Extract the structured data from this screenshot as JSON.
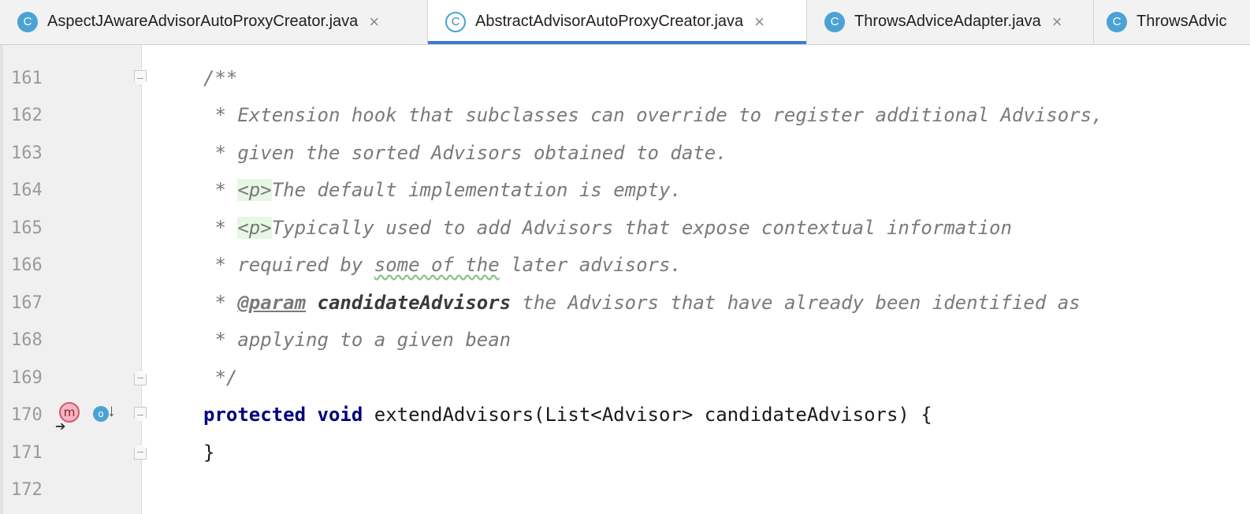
{
  "tabs": [
    {
      "label": "AspectJAwareAdvisorAutoProxyCreator.java",
      "icon": "class-icon",
      "icon_glyph": "C",
      "active": false
    },
    {
      "label": "AbstractAdvisorAutoProxyCreator.java",
      "icon": "class-icon",
      "icon_glyph": "C",
      "active": true
    },
    {
      "label": "ThrowsAdviceAdapter.java",
      "icon": "class-icon",
      "icon_glyph": "C",
      "active": false
    },
    {
      "label": "ThrowsAdvic",
      "icon": "class-icon",
      "icon_glyph": "C",
      "active": false
    }
  ],
  "close_glyph": "×",
  "gutter": {
    "line_numbers": [
      "161",
      "162",
      "163",
      "164",
      "165",
      "166",
      "167",
      "168",
      "169",
      "170",
      "171",
      "172"
    ],
    "method_marker": "m",
    "override_marker": "o"
  },
  "code": {
    "l161": "/**",
    "l162": " * Extension hook that subclasses can override to register additional Advisors,",
    "l163_prefix": " * given the sorted Advisors obtained to date.",
    "l164_star": " * ",
    "l164_tag": "<p>",
    "l164_text": "The default implementation is empty.",
    "l165_star": " * ",
    "l165_tag": "<p>",
    "l165_text": "Typically used to add Advisors that expose contextual information",
    "l166_a": " * required by ",
    "l166_typo": "some of the",
    "l166_b": " later advisors.",
    "l167_star": " * ",
    "l167_tag": "@param",
    "l167_name": "candidateAdvisors",
    "l167_text": " the Advisors that have already been identified as",
    "l168": " * applying to a given bean",
    "l169": " */",
    "l170_kw1": "protected",
    "l170_kw2": "void",
    "l170_rest": " extendAdvisors(List<Advisor> candidateAdvisors) {",
    "l171": "}"
  },
  "colors": {
    "keyword": "#000080",
    "comment": "#7a7a7a",
    "tab_accent": "#3d7ad6",
    "class_icon": "#4aa3d4"
  }
}
